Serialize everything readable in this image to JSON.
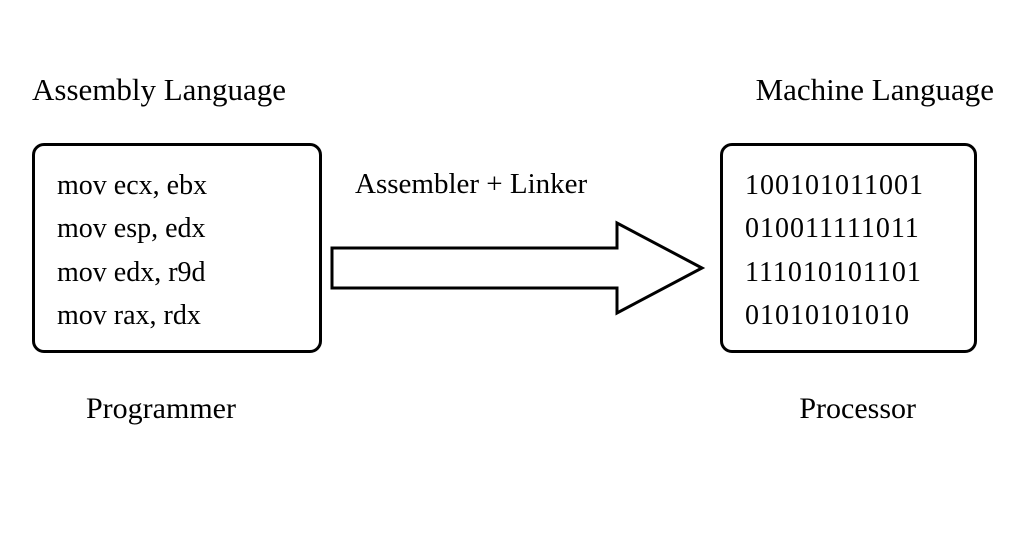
{
  "assembly": {
    "title": "Assembly Language",
    "lines": [
      "mov ecx, ebx",
      "mov esp, edx",
      "mov edx, r9d",
      "mov rax, rdx"
    ],
    "caption": "Programmer"
  },
  "machine": {
    "title": "Machine Language",
    "lines": [
      "100101011001",
      "010011111011",
      "111010101101",
      "01010101010"
    ],
    "caption": "Processor"
  },
  "arrow": {
    "label": "Assembler + Linker"
  }
}
